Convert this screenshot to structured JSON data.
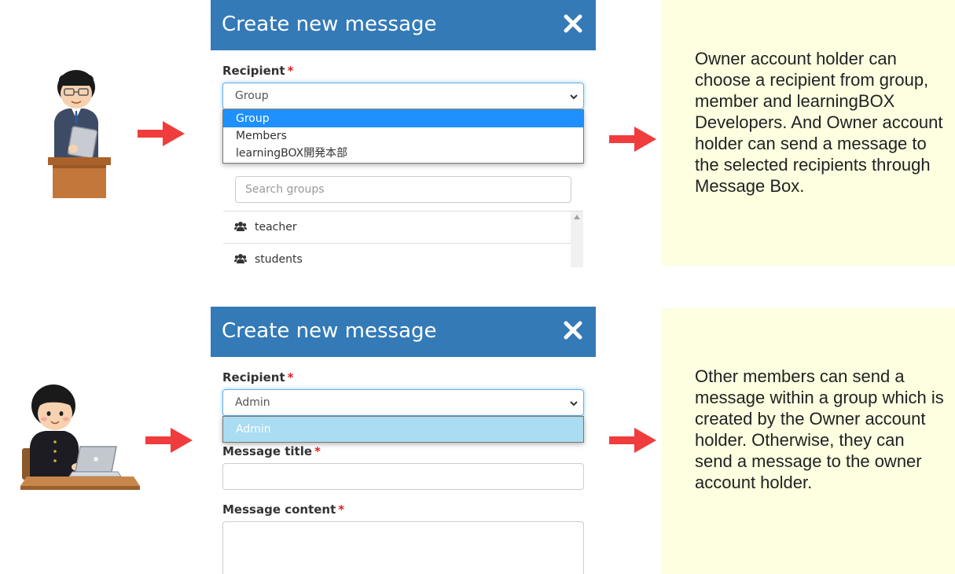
{
  "panel1": {
    "title": "Create new message",
    "close_icon": "close-icon",
    "recipient_label": "Recipient",
    "required_mark": "*",
    "select_value": "Group",
    "options": [
      "Group",
      "Members",
      "learningBOX開発本部"
    ],
    "search_placeholder": "Search groups",
    "groups": [
      {
        "icon": "users-icon",
        "label": "teacher"
      },
      {
        "icon": "users-icon",
        "label": "students"
      }
    ],
    "note": "Owner account holder can choose a recipient from group, member and learningBOX Developers. And Owner account holder can send a message to the selected recipients through Message Box."
  },
  "panel2": {
    "title": "Create new message",
    "close_icon": "close-icon",
    "recipient_label": "Recipient",
    "required_mark": "*",
    "select_value": "Admin",
    "options": [
      "Admin"
    ],
    "title_label": "Message title",
    "content_label": "Message content",
    "note": "Other members can send a message within a group which is created by the Owner account holder. Otherwise, they can send a message to the owner account holder."
  },
  "colors": {
    "header": "#337ab7",
    "arrow": "#f03c3c",
    "note_bg": "#fdffe0",
    "selected_option": "#1e90ff",
    "selected_option_light": "#aadcf2"
  }
}
